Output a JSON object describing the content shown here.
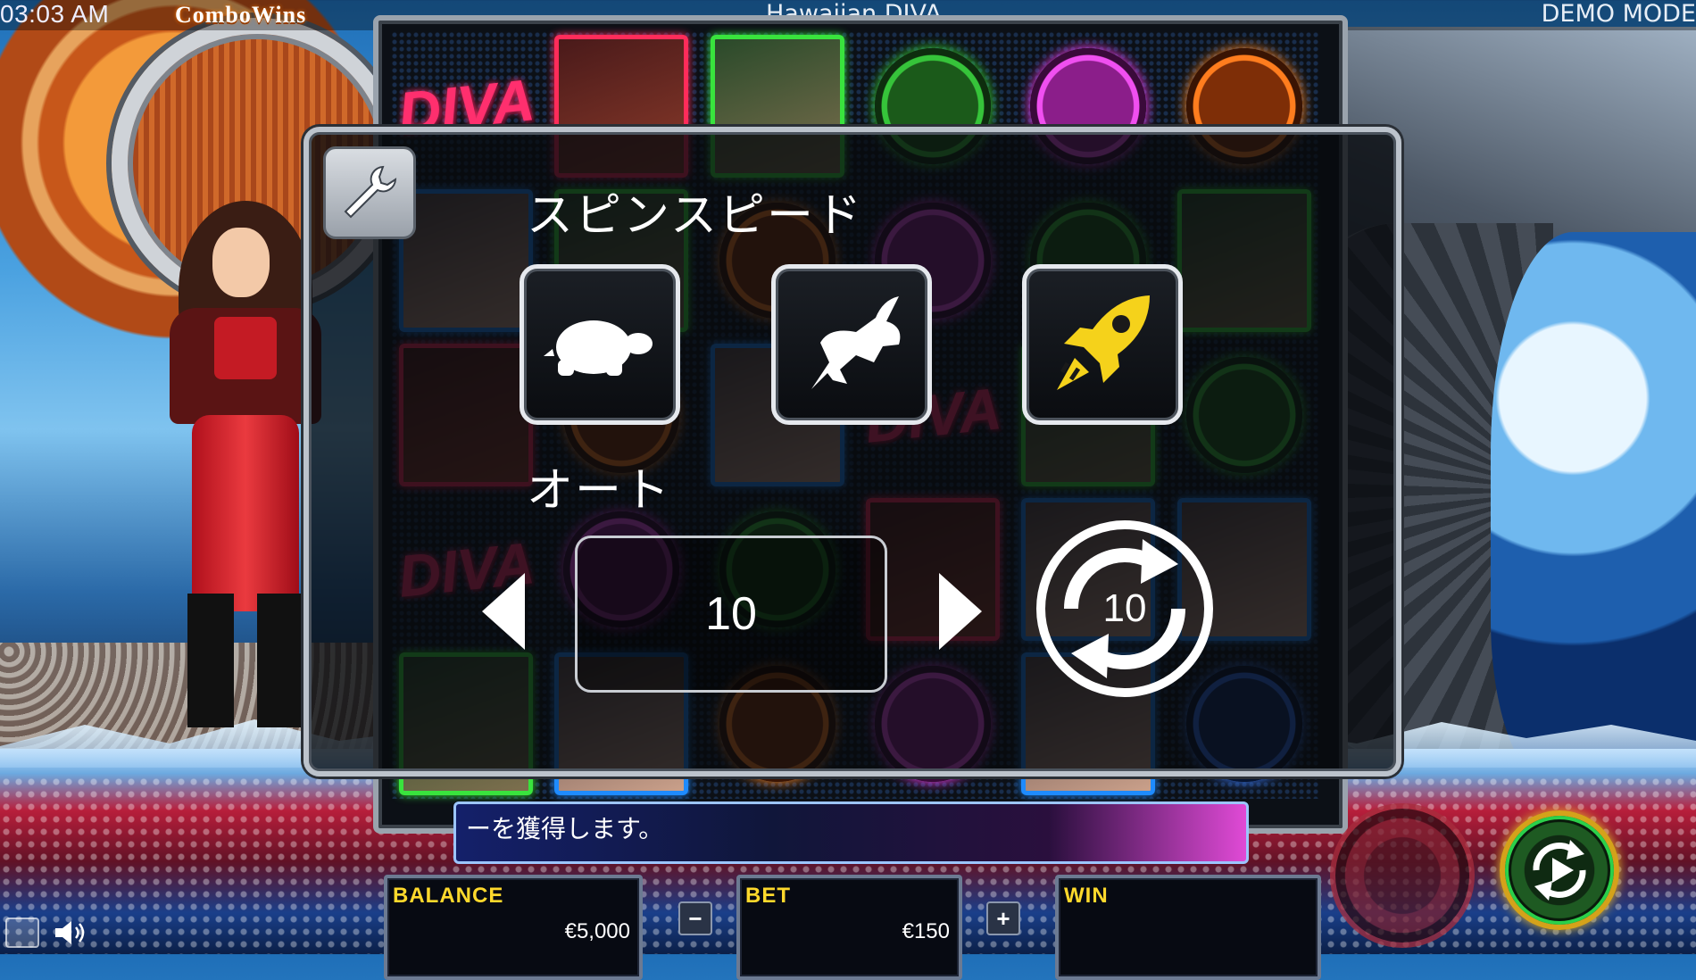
{
  "status_bar": {
    "clock": "03:03 AM",
    "logo": "ComboWins",
    "game_title": "Hawaiian DIVA",
    "mode": "DEMO MODE"
  },
  "reels": {
    "diva_text": "DIVA"
  },
  "settings": {
    "spin_speed_title": "スピンスピード",
    "speed_options": [
      "turtle-icon",
      "rabbit-icon",
      "rocket-icon"
    ],
    "auto_title": "オート",
    "auto_count": "10",
    "auto_start_count": "10"
  },
  "message": {
    "text": "ーを獲得します。"
  },
  "panels": {
    "balance_label": "BALANCE",
    "balance_value": "€5,000",
    "bet_label": "BET",
    "bet_value": "€150",
    "win_label": "WIN",
    "win_value": "",
    "minus": "−",
    "plus": "+"
  },
  "colors": {
    "panel_label": "#ffd92c",
    "modal_border": "#bcc3cc",
    "rocket": "#f5d21b"
  }
}
